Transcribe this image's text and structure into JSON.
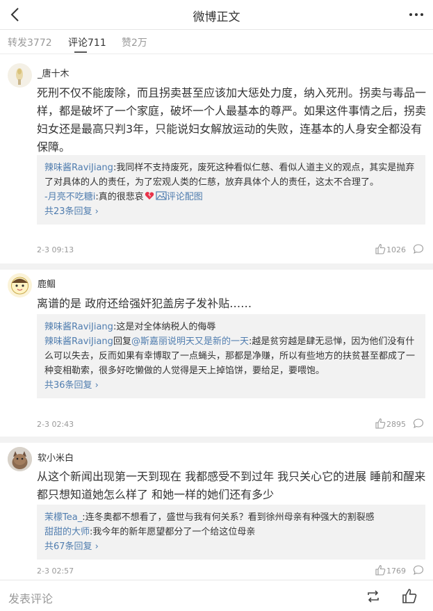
{
  "header": {
    "title": "微博正文",
    "back_icon": "chevron-left-icon",
    "more_icon": "more-dots-icon"
  },
  "tabs": [
    {
      "label": "转发3772",
      "active": false
    },
    {
      "label": "评论711",
      "active": true
    },
    {
      "label": "赞2万",
      "active": false
    }
  ],
  "comments": [
    {
      "user": "_唐十木",
      "text": "死刑不仅不能废除，而且拐卖甚至应该加大惩处力度，纳入死刑。拐卖与毒品一样，都是破坏了一个家庭，破坏一个人最基本的尊严。如果这件事情之后，拐卖妇女还是最高只判3年，只能说妇女解放运动的失败，连基本的人身安全都没有保障。",
      "replies": [
        {
          "name": "辣味酱RaviJiang",
          "text": ":我同样不支持废死，废死这种看似仁慈、看似人道主义的观点，其实是抛弃了对具体的人的责任，为了宏观人类的仁慈，放弃具体个人的责任，这太不合理了。"
        },
        {
          "name": "-月亮不吃糖i",
          "text": ":真的很悲哀",
          "extra": "评论配图"
        }
      ],
      "more_replies": "共23条回复",
      "time": "2-3 09:13",
      "likes": "1026"
    },
    {
      "user": "鹿鲴",
      "text": "离谱的是 政府还给强奸犯盖房子发补贴……",
      "replies": [
        {
          "name": "辣味酱RaviJiang",
          "text": ":这是对全体纳税人的侮辱"
        },
        {
          "name": "辣味酱RaviJiang",
          "reply_word": "回复",
          "mention": "@斯嘉丽说明天又是新的一天",
          "text": ":越是贫穷越是肆无忌惮，因为他们没有什么可以失去，反而如果有幸博取了一点蝇头，那都是净赚，所以有些地方的扶贫甚至都成了一种变相勒索，很多好吃懒做的人觉得是天上掉馅饼，要给足，要喂饱。"
        }
      ],
      "more_replies": "共36条回复",
      "time": "2-3 02:43",
      "likes": "2895"
    },
    {
      "user": "软小米白",
      "text": "从这个新闻出现第一天到现在 我都感受不到过年 我只关心它的进展 睡前和醒来都只想知道她怎么样了 和她一样的她们还有多少",
      "replies": [
        {
          "name": "茉檬Tea_",
          "text": ":连冬奥都不想看了，盛世与我有何关系？看到徐州母亲有种强大的割裂感"
        },
        {
          "name": "甜甜的大师",
          "text": ":我今年的新年愿望都分了一个给这位母亲"
        }
      ],
      "more_replies": "共67条回复",
      "time": "2-3 02:57",
      "likes": "1769"
    }
  ],
  "bottom": {
    "placeholder": "发表评论"
  },
  "colors": {
    "link": "#507daf",
    "muted": "#999999",
    "separator": "#f2f2f2",
    "text": "#333333"
  }
}
